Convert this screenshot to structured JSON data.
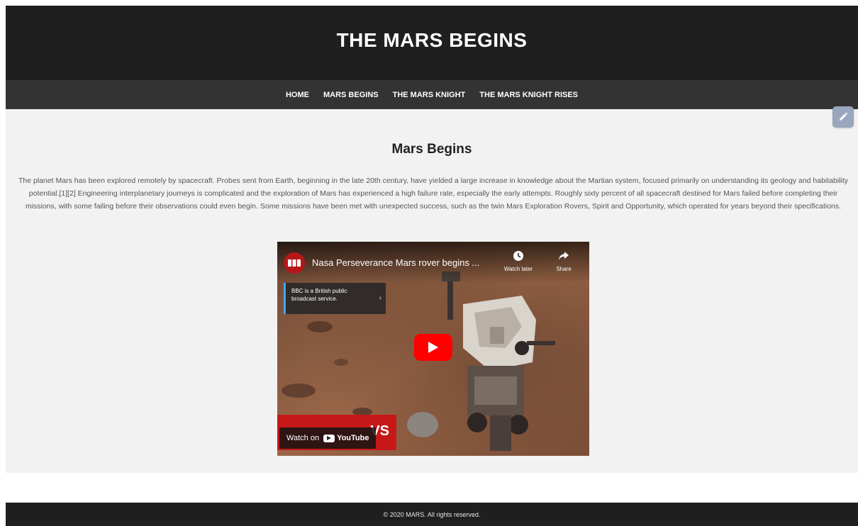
{
  "header": {
    "title": "THE MARS BEGINS"
  },
  "nav": {
    "items": [
      {
        "label": "HOME"
      },
      {
        "label": "MARS BEGINS"
      },
      {
        "label": "THE MARS KNIGHT"
      },
      {
        "label": "THE MARS KNIGHT RISES"
      }
    ]
  },
  "main": {
    "heading": "Mars Begins",
    "paragraph": "The planet Mars has been explored remotely by spacecraft. Probes sent from Earth, beginning in the late 20th century, have yielded a large increase in knowledge about the Martian system, focused primarily on understanding its geology and habitability potential.[1][2] Engineering interplanetary journeys is complicated and the exploration of Mars has experienced a high failure rate, especially the early attempts. Roughly sixty percent of all spacecraft destined for Mars failed before completing their missions, with some failing before their observations could even begin. Some missions have been met with unexpected success, such as the twin Mars Exploration Rovers, Spirit and Opportunity, which operated for years beyond their specifications."
  },
  "video": {
    "title": "Nasa Perseverance Mars rover begins ...",
    "channel_badge": "BBC",
    "watch_later_label": "Watch later",
    "share_label": "Share",
    "info_panel_text": "BBC is a British public broadcast service.",
    "watch_on_label": "Watch on",
    "youtube_label": "YouTube",
    "banner_text": "VS"
  },
  "footer": {
    "text": "© 2020 MARS. All rights reserved."
  },
  "colors": {
    "header_bg": "#1f1f1f",
    "nav_bg": "#333333",
    "main_bg": "#f2f2f2",
    "youtube_red": "#ff0000"
  }
}
